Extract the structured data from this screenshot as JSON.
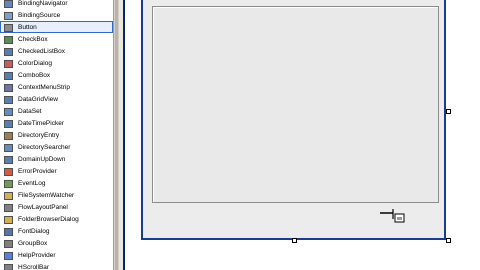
{
  "toolbox": {
    "items": [
      {
        "label": "BindingNavigator",
        "icon": "binding-navigator-icon",
        "color": "#4a6fb5",
        "selected": false
      },
      {
        "label": "BindingSource",
        "icon": "binding-source-icon",
        "color": "#6a8fc0",
        "selected": false
      },
      {
        "label": "Button",
        "icon": "button-icon",
        "color": "#7a7a7a",
        "selected": true
      },
      {
        "label": "CheckBox",
        "icon": "checkbox-icon",
        "color": "#3a7a3a",
        "selected": false
      },
      {
        "label": "CheckedListBox",
        "icon": "checked-listbox-icon",
        "color": "#3a6aa5",
        "selected": false
      },
      {
        "label": "ColorDialog",
        "icon": "color-dialog-icon",
        "color": "#c04040",
        "selected": false
      },
      {
        "label": "ComboBox",
        "icon": "combobox-icon",
        "color": "#3a6aa5",
        "selected": false
      },
      {
        "label": "ContextMenuStrip",
        "icon": "context-menu-strip-icon",
        "color": "#5a5a9a",
        "selected": false
      },
      {
        "label": "DataGridView",
        "icon": "data-grid-view-icon",
        "color": "#3a6aa5",
        "selected": false
      },
      {
        "label": "DataSet",
        "icon": "dataset-icon",
        "color": "#4a7ab5",
        "selected": false
      },
      {
        "label": "DateTimePicker",
        "icon": "date-time-picker-icon",
        "color": "#3a6aa5",
        "selected": false
      },
      {
        "label": "DirectoryEntry",
        "icon": "directory-entry-icon",
        "color": "#8a6a3a",
        "selected": false
      },
      {
        "label": "DirectorySearcher",
        "icon": "directory-searcher-icon",
        "color": "#4a7ab5",
        "selected": false
      },
      {
        "label": "DomainUpDown",
        "icon": "domain-updown-icon",
        "color": "#3a6aa5",
        "selected": false
      },
      {
        "label": "ErrorProvider",
        "icon": "error-provider-icon",
        "color": "#d04020",
        "selected": false
      },
      {
        "label": "EventLog",
        "icon": "event-log-icon",
        "color": "#5a8a3a",
        "selected": false
      },
      {
        "label": "FileSystemWatcher",
        "icon": "file-system-watcher-icon",
        "color": "#c8a040",
        "selected": false
      },
      {
        "label": "FlowLayoutPanel",
        "icon": "flow-layout-panel-icon",
        "color": "#6a6a6a",
        "selected": false
      },
      {
        "label": "FolderBrowserDialog",
        "icon": "folder-browser-dialog-icon",
        "color": "#d0a030",
        "selected": false
      },
      {
        "label": "FontDialog",
        "icon": "font-dialog-icon",
        "color": "#3a5aa5",
        "selected": false
      },
      {
        "label": "GroupBox",
        "icon": "groupbox-icon",
        "color": "#6a6a6a",
        "selected": false
      },
      {
        "label": "HelpProvider",
        "icon": "help-provider-icon",
        "color": "#3a6ad5",
        "selected": false
      },
      {
        "label": "HScrollBar",
        "icon": "hscrollbar-icon",
        "color": "#6a6a6a",
        "selected": false
      }
    ]
  },
  "colors": {
    "selection_border": "#316ac5",
    "form_border": "#1c3c8c",
    "form_fill": "#ececec"
  },
  "cursor": {
    "icon": "add-control-cursor-icon"
  }
}
